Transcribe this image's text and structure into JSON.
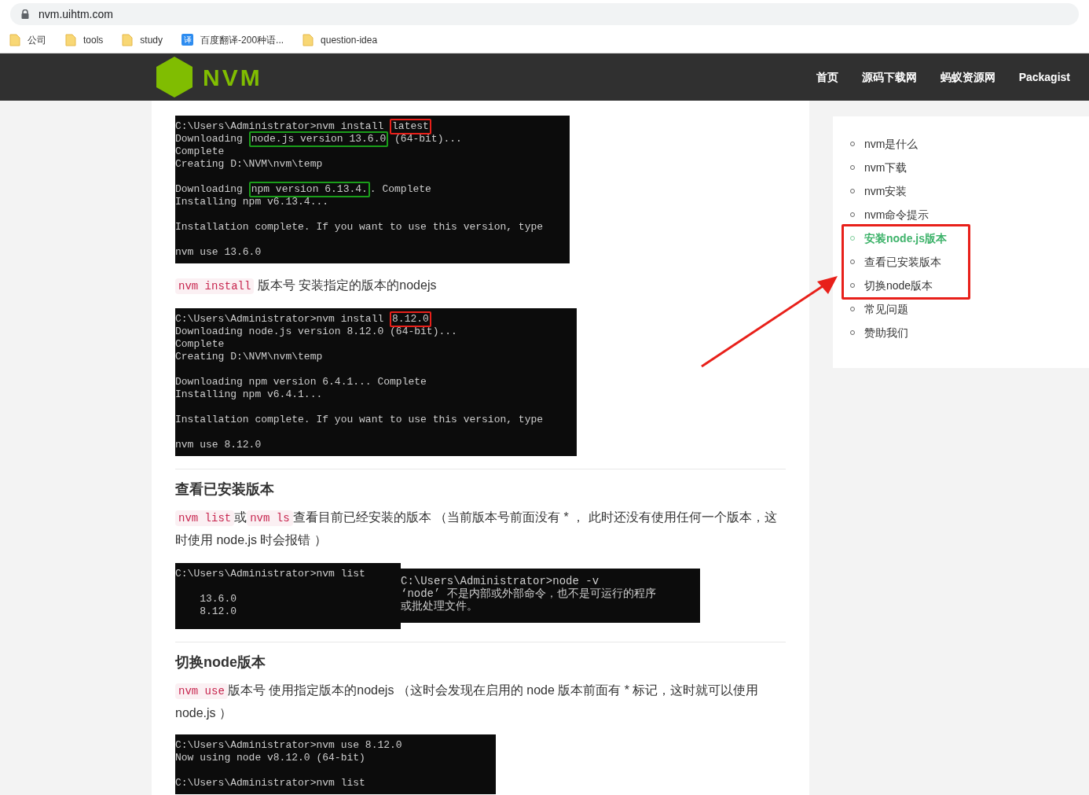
{
  "browser": {
    "url": "nvm.uihtm.com",
    "bookmarks": [
      {
        "label": "公司",
        "kind": "folder"
      },
      {
        "label": "tools",
        "kind": "folder"
      },
      {
        "label": "study",
        "kind": "folder"
      },
      {
        "label": "百度翻译-200种语...",
        "kind": "app",
        "glyph": "译"
      },
      {
        "label": "question-idea",
        "kind": "folder"
      }
    ]
  },
  "header": {
    "logo": "NVM",
    "nav": [
      "首页",
      "源码下载网",
      "蚂蚁资源网",
      "Packagist"
    ]
  },
  "content": [
    {
      "kind": "terminal",
      "groups": [
        [
          [
            {
              "text": "C:\\Users\\Administrator>nvm install "
            },
            {
              "text": "latest",
              "color": "#e8201a"
            }
          ],
          [
            {
              "text": "Downloading "
            },
            {
              "text": "node.js version 13.6.0",
              "color": "#1a9e1a"
            },
            {
              "text": " (64-bit)..."
            }
          ],
          [
            {
              "text": "Complete"
            }
          ],
          [
            {
              "text": "Creating D:\\NVM\\nvm\\temp"
            }
          ]
        ],
        [
          [
            {
              "text": "Downloading "
            },
            {
              "text": "npm version 6.13.4.",
              "color": "#1a9e1a"
            },
            {
              "text": ". Complete"
            }
          ],
          [
            {
              "text": "Installing npm v6.13.4..."
            }
          ]
        ],
        [
          [
            {
              "text": "Installation complete. If you want to use this version, type"
            }
          ]
        ],
        [
          [
            {
              "text": "nvm use 13.6.0"
            }
          ]
        ]
      ]
    },
    {
      "kind": "paragraph",
      "parts": [
        {
          "kind": "code",
          "text": "nvm install"
        },
        {
          "kind": "text",
          "text": " 版本号 安装指定的版本的nodejs"
        }
      ]
    },
    {
      "kind": "terminal",
      "groups": [
        [
          [
            {
              "text": "C:\\Users\\Administrator>nvm install "
            },
            {
              "text": "8.12.0",
              "color": "#e8201a"
            }
          ],
          [
            {
              "text": "Downloading node.js version 8.12.0 (64-bit)..."
            }
          ],
          [
            {
              "text": "Complete"
            }
          ],
          [
            {
              "text": "Creating D:\\NVM\\nvm\\temp"
            }
          ]
        ],
        [
          [
            {
              "text": "Downloading npm version 6.4.1... Complete"
            }
          ],
          [
            {
              "text": "Installing npm v6.4.1..."
            }
          ]
        ],
        [
          [
            {
              "text": "Installation complete. If you want to use this version, type"
            }
          ]
        ],
        [
          [
            {
              "text": "nvm use 8.12.0"
            }
          ]
        ]
      ]
    },
    {
      "kind": "divider"
    },
    {
      "kind": "heading",
      "text": "查看已安装版本"
    },
    {
      "kind": "paragraph",
      "parts": [
        {
          "kind": "code",
          "text": "nvm list"
        },
        {
          "kind": "text",
          "text": "或"
        },
        {
          "kind": "code",
          "text": "nvm ls"
        },
        {
          "kind": "text",
          "text": "查看目前已经安装的版本 （当前版本号前面没有 * ， 此时还没有使用任何一个版本，这时使用 node.js 时会报错 ）"
        }
      ]
    },
    {
      "kind": "terminal_pair",
      "terminals": [
        {
          "groups": [
            [
              [
                {
                  "text": "C:\\Users\\Administrator>nvm list"
                }
              ]
            ],
            [
              [
                {
                  "text": "    13.6.0"
                }
              ],
              [
                {
                  "text": "    8.12.0"
                }
              ]
            ]
          ]
        },
        {
          "groups": [
            [
              [
                {
                  "text": "C:\\Users\\Administrator>node -v"
                }
              ],
              [
                {
                  "text": "‘node’ 不是内部或外部命令，也不是可运行的程序"
                }
              ],
              [
                {
                  "text": "或批处理文件。"
                }
              ]
            ]
          ]
        }
      ]
    },
    {
      "kind": "divider"
    },
    {
      "kind": "heading",
      "text": "切换node版本"
    },
    {
      "kind": "paragraph",
      "parts": [
        {
          "kind": "code",
          "text": "nvm use"
        },
        {
          "kind": "text",
          "text": "版本号 使用指定版本的nodejs （这时会发现在启用的 node 版本前面有 * 标记，这时就可以使用 node.js ）"
        }
      ]
    },
    {
      "kind": "terminal",
      "groups": [
        [
          [
            {
              "text": "C:\\Users\\Administrator>nvm use 8.12.0"
            }
          ],
          [
            {
              "text": "Now using node v8.12.0 (64-bit)"
            }
          ]
        ],
        [
          [
            {
              "text": "C:\\Users\\Administrator>nvm list"
            }
          ]
        ]
      ]
    }
  ],
  "toc": {
    "items": [
      {
        "label": "nvm是什么",
        "selected": false,
        "boxed": false
      },
      {
        "label": "nvm下载",
        "selected": false,
        "boxed": false
      },
      {
        "label": "nvm安装",
        "selected": false,
        "boxed": false
      },
      {
        "label": "nvm命令提示",
        "selected": false,
        "boxed": false
      },
      {
        "label": "安装node.js版本",
        "selected": true,
        "boxed": true
      },
      {
        "label": "查看已安装版本",
        "selected": false,
        "boxed": true
      },
      {
        "label": "切换node版本",
        "selected": false,
        "boxed": true
      },
      {
        "label": "常见问题",
        "selected": false,
        "boxed": false
      },
      {
        "label": "赞助我们",
        "selected": false,
        "boxed": false
      }
    ]
  }
}
